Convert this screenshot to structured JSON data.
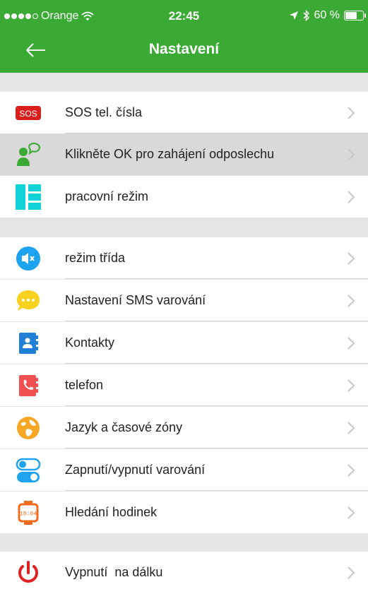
{
  "status_bar": {
    "carrier": "Orange",
    "time": "22:45",
    "battery": "60 %"
  },
  "header": {
    "title": "Nastavení"
  },
  "colors": {
    "header": "#3aaa35"
  },
  "sections": [
    {
      "items": [
        {
          "label": "SOS tel. čísla",
          "icon": "sos-badge-icon",
          "icon_text": "SOS"
        },
        {
          "label": "Klikněte OK pro zahájení odposlechu",
          "icon": "listen-person-icon",
          "highlighted": true
        },
        {
          "label": "pracovní režim",
          "icon": "work-mode-icon"
        }
      ]
    },
    {
      "items": [
        {
          "label": "režim třída",
          "icon": "mute-speaker-icon"
        },
        {
          "label": "Nastavení SMS varování",
          "icon": "sms-bubble-icon"
        },
        {
          "label": "Kontakty",
          "icon": "contacts-book-icon"
        },
        {
          "label": "telefon",
          "icon": "phone-book-icon"
        },
        {
          "label": "Jazyk a časové zóny",
          "icon": "globe-icon"
        },
        {
          "label": "Zapnutí/vypnutí varování",
          "icon": "toggle-switch-icon"
        },
        {
          "label": "Hledání hodinek",
          "icon": "watch-icon",
          "icon_text": "18:04"
        }
      ]
    },
    {
      "items": [
        {
          "label": "Vypnutí  na dálku",
          "icon": "power-icon"
        }
      ]
    }
  ]
}
